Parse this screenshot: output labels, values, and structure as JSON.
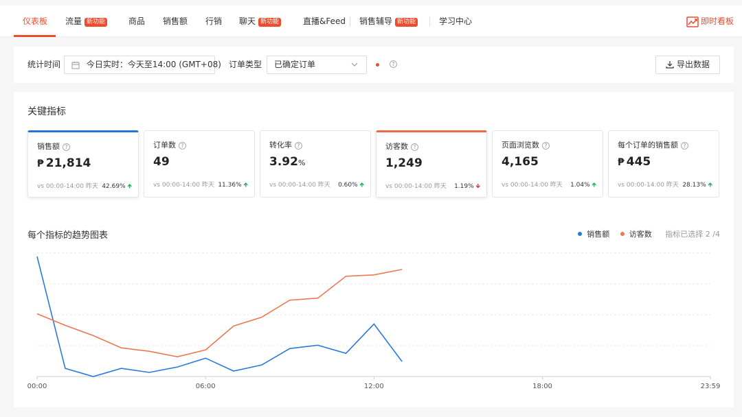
{
  "nav": {
    "items": [
      {
        "label": "仪表板",
        "active": true
      },
      {
        "label": "流量",
        "badge": "新功能"
      },
      {
        "label": "商品"
      },
      {
        "label": "销售额"
      },
      {
        "label": "行销"
      },
      {
        "label": "聊天",
        "badge": "新功能"
      },
      {
        "label": "直播&Feed"
      },
      {
        "label": "销售辅导",
        "badge": "新功能"
      },
      {
        "label": "学习中心"
      }
    ],
    "live_board": "即时看板"
  },
  "filters": {
    "time_label": "统计时间",
    "time_value": "今日实时：今天至14:00 (GMT+08)",
    "order_type_label": "订单类型",
    "order_type_value": "已确定订单",
    "help": "?",
    "export": "导出数据"
  },
  "metrics": {
    "title": "关键指标",
    "cards": [
      {
        "label": "销售额",
        "currency": "₱",
        "value": "21,814",
        "compare": "vs 00:00-14:00 昨天",
        "change": "42.69%",
        "direction": "up",
        "selected": "blue"
      },
      {
        "label": "订单数",
        "value": "49",
        "compare": "vs 00:00-14:00 昨天",
        "change": "11.36%",
        "direction": "up"
      },
      {
        "label": "转化率",
        "value": "3.92",
        "unit": "%",
        "compare": "vs 00:00-14:00 昨天",
        "change": "0.60%",
        "direction": "up"
      },
      {
        "label": "访客数",
        "value": "1,249",
        "compare": "vs 00:00-14:00 昨天",
        "change": "1.19%",
        "direction": "down",
        "selected": "orange"
      },
      {
        "label": "页面浏览数",
        "value": "4,165",
        "compare": "vs 00:00-14:00 昨天",
        "change": "1.04%",
        "direction": "up"
      },
      {
        "label": "每个订单的销售额",
        "currency": "₱",
        "value": "445",
        "compare": "vs 00:00-14:00 昨天",
        "change": "28.13%",
        "direction": "up"
      }
    ]
  },
  "trend": {
    "title": "每个指标的趋势图表",
    "legend": [
      {
        "name": "销售额",
        "color": "#2a78dc"
      },
      {
        "name": "访客数",
        "color": "#f0764f"
      }
    ],
    "selected_count": "指标已选择 2 /4"
  },
  "chart_data": {
    "type": "line",
    "x": [
      "00:00",
      "01:00",
      "02:00",
      "03:00",
      "04:00",
      "05:00",
      "06:00",
      "07:00",
      "08:00",
      "09:00",
      "10:00",
      "11:00",
      "12:00",
      "13:00"
    ],
    "xticks": [
      "00:00",
      "06:00",
      "12:00",
      "18:00",
      "23:59"
    ],
    "series": [
      {
        "name": "销售额",
        "color": "#2a78dc",
        "values": [
          176,
          12,
          0,
          12,
          6,
          14,
          27,
          8,
          17,
          41,
          46,
          34,
          77,
          22
        ]
      },
      {
        "name": "访客数",
        "color": "#f0764f",
        "values": [
          92,
          75,
          60,
          42,
          37,
          29,
          39,
          74,
          87,
          112,
          115,
          147,
          149,
          157
        ]
      }
    ],
    "ylim": [
      0,
      176
    ],
    "grid": true
  }
}
